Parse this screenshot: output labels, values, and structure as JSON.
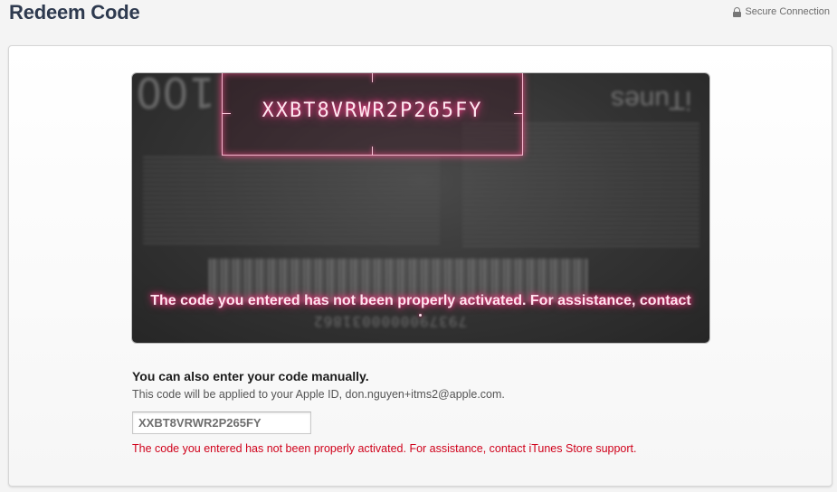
{
  "header": {
    "title": "Redeem Code",
    "secure_label": "Secure Connection"
  },
  "card": {
    "scanned_code": "XXBT8VRWR2P265FY",
    "error_message": "The code you entered has not been properly activated. For assistance, contact",
    "background_amount": "100",
    "background_brand": "iTunes",
    "background_barcode_number": "7937900000031862"
  },
  "manual": {
    "title": "You can also enter your code manually.",
    "subtitle": "This code will be applied to your Apple ID, don.nguyen+itms2@apple.com.",
    "input_value": "XXBT8VRWR2P265FY",
    "error_message": "The code you entered has not been properly activated. For assistance, contact iTunes Store support."
  },
  "colors": {
    "title": "#2e3a4f",
    "error": "#d0021b",
    "glow": "#ff3d8a"
  },
  "icons": {
    "secure": "lock-icon"
  }
}
